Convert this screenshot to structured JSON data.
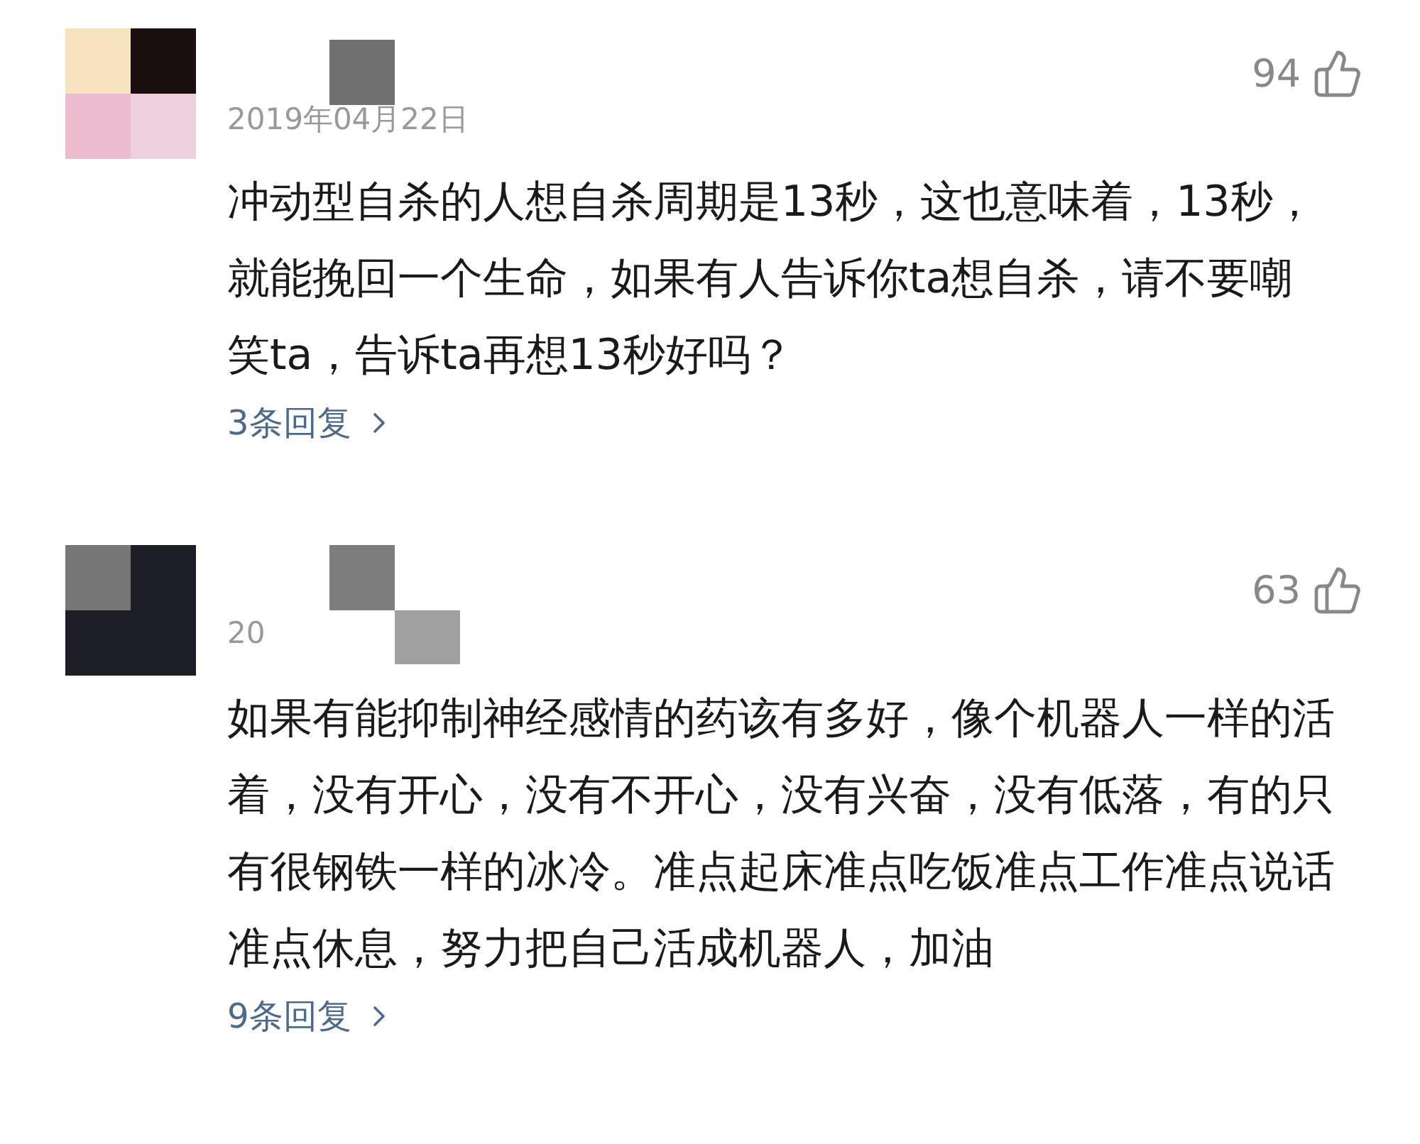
{
  "comments": [
    {
      "date": "2019年04月22日",
      "likes": "94",
      "text": "冲动型自杀的人想自杀周期是13秒，这也意味着，13秒，就能挽回一个生命，如果有人告诉你ta想自杀，请不要嘲笑ta，告诉ta再想13秒好吗？",
      "replies": "3条回复"
    },
    {
      "date": "20",
      "likes": "63",
      "text": "如果有能抑制神经感情的药该有多好，像个机器人一样的活着，没有开心，没有不开心，没有兴奋，没有低落，有的只有很钢铁一样的冰冷。准点起床准点吃饭准点工作准点说话准点休息，努力把自己活成机器人，加油",
      "replies": "9条回复"
    }
  ]
}
